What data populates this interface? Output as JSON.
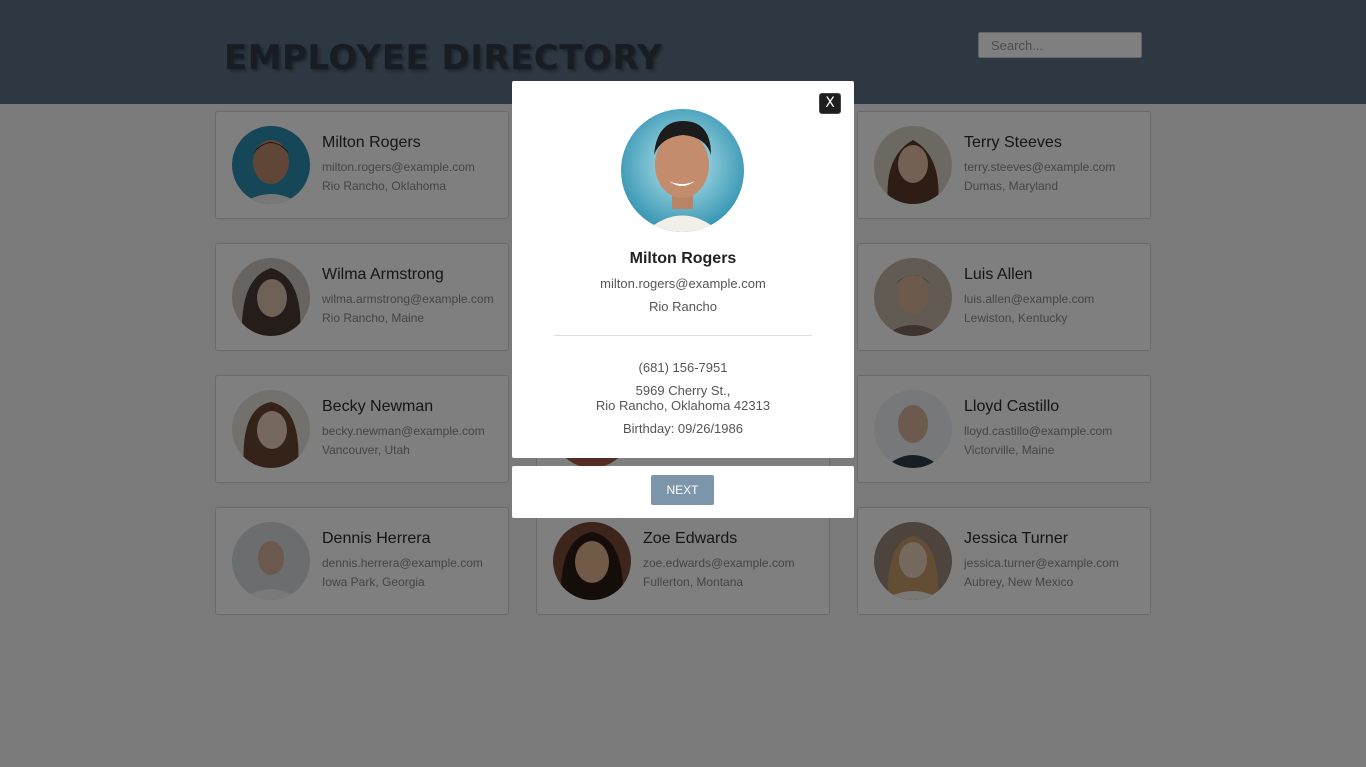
{
  "header": {
    "title": "EMPLOYEE DIRECTORY",
    "search_placeholder": "Search..."
  },
  "employees": [
    {
      "name": "Milton Rogers",
      "email": "milton.rogers@example.com",
      "location": "Rio Rancho, Oklahoma",
      "bg": "#c08c6e"
    },
    {
      "name": "Terry Steeves",
      "email": "terry.steeves@example.com",
      "location": "Dumas, Maryland",
      "bg": "#8a6a55"
    },
    {
      "name": "Wilma Armstrong",
      "email": "wilma.armstrong@example.com",
      "location": "Rio Rancho, Maine",
      "bg": "#6e5a52"
    },
    {
      "name": "Luis Allen",
      "email": "luis.allen@example.com",
      "location": "Lewiston, Kentucky",
      "bg": "#9c8a7a"
    },
    {
      "name": "Becky Newman",
      "email": "becky.newman@example.com",
      "location": "Vancouver, Utah",
      "bg": "#8e6a5a"
    },
    {
      "name": "Lloyd Castillo",
      "email": "lloyd.castillo@example.com",
      "location": "Victorville, Maine",
      "bg": "#b8bfc8"
    },
    {
      "name": "Dennis Herrera",
      "email": "dennis.herrera@example.com",
      "location": "Iowa Park, Georgia",
      "bg": "#c7cbd0"
    },
    {
      "name": "Zoe Edwards",
      "email": "zoe.edwards@example.com",
      "location": "Fullerton, Montana",
      "bg": "#a0704f"
    },
    {
      "name": "Jessica Turner",
      "email": "jessica.turner@example.com",
      "location": "Aubrey, New Mexico",
      "bg": "#b89a80"
    }
  ],
  "modal": {
    "close_label": "X",
    "name": "Milton Rogers",
    "email": "milton.rogers@example.com",
    "city": "Rio Rancho",
    "phone": "(681) 156-7951",
    "address_line1": "5969 Cherry St.,",
    "address_line2": "Rio Rancho, Oklahoma 42313",
    "birthday": "Birthday: 09/26/1986",
    "next_label": "NEXT"
  }
}
